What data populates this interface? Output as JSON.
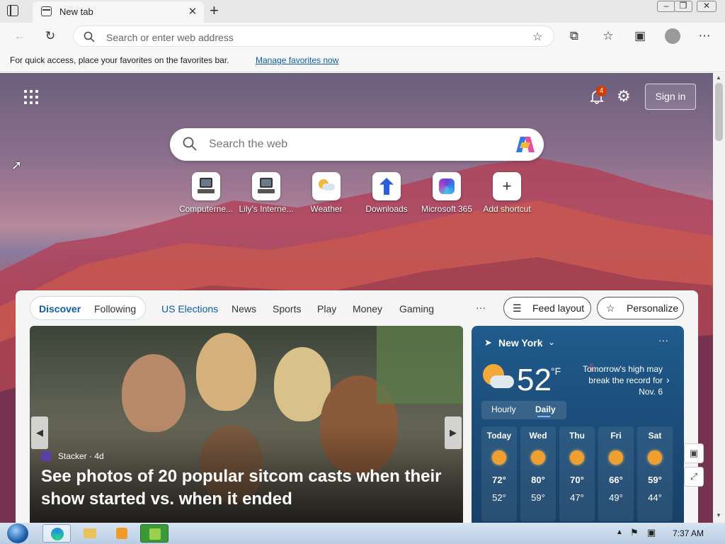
{
  "browser": {
    "tab_title": "New tab",
    "address_placeholder": "Search or enter web address",
    "favorites_message": "For quick access, place your favorites on the favorites bar.",
    "favorites_link": "Manage favorites now"
  },
  "ntp": {
    "notification_count": "4",
    "signin_label": "Sign in",
    "search_placeholder": "Search the web",
    "shortcuts": [
      {
        "label": "Computerne..."
      },
      {
        "label": "Lily's Interne..."
      },
      {
        "label": "Weather"
      },
      {
        "label": "Downloads"
      },
      {
        "label": "Microsoft 365"
      },
      {
        "label": "Add shortcut"
      }
    ]
  },
  "feed": {
    "tabs": [
      "Discover",
      "Following",
      "US Elections",
      "News",
      "Sports",
      "Play",
      "Money",
      "Gaming"
    ],
    "more": "···",
    "feed_layout_label": "Feed layout",
    "personalize_label": "Personalize",
    "hero": {
      "source": "Stacker · 4d",
      "headline": "See photos of 20 popular sitcom casts when their show started vs. when it ended"
    }
  },
  "weather": {
    "city": "New York",
    "temp": "52",
    "unit": "°F",
    "alert": "Tomorrow's high may break the record for Nov. 6",
    "tabs": [
      "Hourly",
      "Daily"
    ],
    "days": [
      {
        "day": "Today",
        "hi": "72°",
        "lo": "52°"
      },
      {
        "day": "Wed",
        "hi": "80°",
        "lo": "59°"
      },
      {
        "day": "Thu",
        "hi": "70°",
        "lo": "47°"
      },
      {
        "day": "Fri",
        "hi": "66°",
        "lo": "49°"
      },
      {
        "day": "Sat",
        "hi": "59°",
        "lo": "44°"
      }
    ]
  },
  "taskbar": {
    "clock": "7:37 AM"
  },
  "colors": {
    "accent": "#0b5cad",
    "badge": "#d83b01"
  }
}
